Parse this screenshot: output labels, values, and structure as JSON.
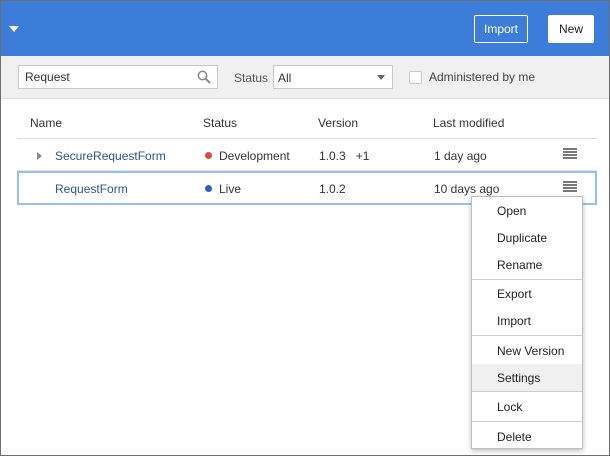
{
  "header": {
    "import_label": "Import",
    "new_label": "New"
  },
  "filters": {
    "search_value": "Request",
    "status_label": "Status",
    "status_value": "All",
    "administered_label": "Administered by me"
  },
  "table": {
    "columns": [
      "Name",
      "Status",
      "Version",
      "Last modified"
    ],
    "rows": [
      {
        "name": "SecureRequestForm",
        "status": "Development",
        "status_color": "#e0483c",
        "version": "1.0.3",
        "version_extra": "+1",
        "modified": "1 day ago"
      },
      {
        "name": "RequestForm",
        "status": "Live",
        "status_color": "#2b5fc4",
        "version": "1.0.2",
        "version_extra": "",
        "modified": "10 days ago"
      }
    ]
  },
  "context_menu": {
    "items": [
      "Open",
      "Duplicate",
      "Rename",
      "Export",
      "Import",
      "New Version",
      "Settings",
      "Lock",
      "Delete"
    ],
    "highlighted": "Settings"
  },
  "colors": {
    "header_bg": "#3b7dd8",
    "selected_row_border": "#97c0f2"
  },
  "icons": [
    "dropdown-caret-icon",
    "search-icon",
    "expand-triangle-icon",
    "row-menu-icon"
  ]
}
